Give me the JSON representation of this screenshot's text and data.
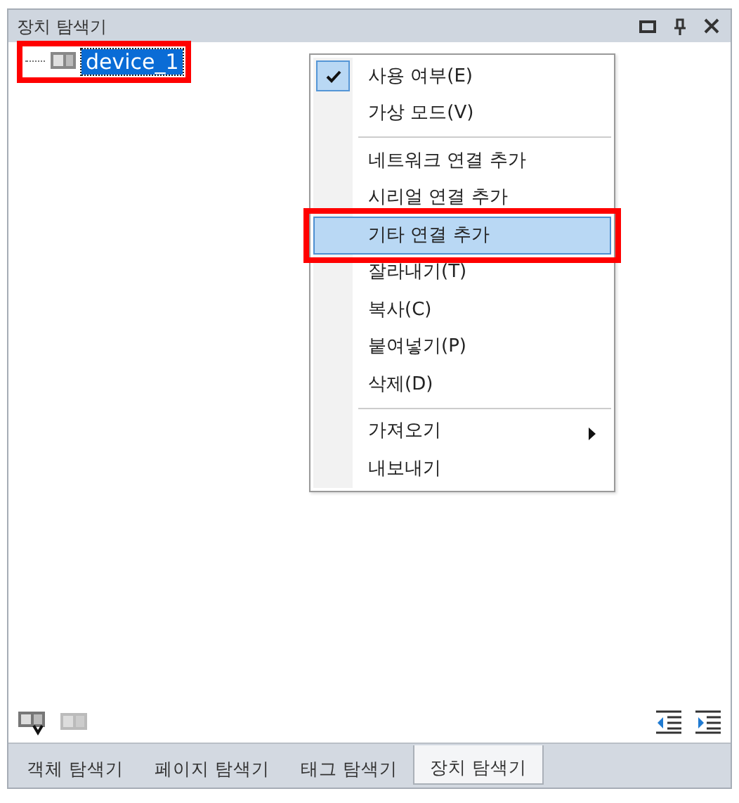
{
  "panel": {
    "title": "장치 탐색기"
  },
  "tree": [
    {
      "label": "device_1",
      "selected": true,
      "highlighted": true
    }
  ],
  "context_menu": [
    {
      "kind": "item",
      "label": "사용 여부(E)",
      "checked": true,
      "selected": false,
      "highlighted": false,
      "submenu": false
    },
    {
      "kind": "item",
      "label": "가상 모드(V)",
      "checked": false,
      "selected": false,
      "highlighted": false,
      "submenu": false
    },
    {
      "kind": "separator"
    },
    {
      "kind": "item",
      "label": "네트워크 연결 추가",
      "checked": false,
      "selected": false,
      "highlighted": false,
      "submenu": false
    },
    {
      "kind": "item",
      "label": "시리얼 연결 추가",
      "checked": false,
      "selected": false,
      "highlighted": false,
      "submenu": false
    },
    {
      "kind": "item",
      "label": "기타 연결 추가",
      "checked": false,
      "selected": true,
      "highlighted": true,
      "submenu": false
    },
    {
      "kind": "item",
      "label": "잘라내기(T)",
      "checked": false,
      "selected": false,
      "highlighted": false,
      "submenu": false
    },
    {
      "kind": "item",
      "label": "복사(C)",
      "checked": false,
      "selected": false,
      "highlighted": false,
      "submenu": false
    },
    {
      "kind": "item",
      "label": "붙여넣기(P)",
      "checked": false,
      "selected": false,
      "highlighted": false,
      "submenu": false
    },
    {
      "kind": "item",
      "label": "삭제(D)",
      "checked": false,
      "selected": false,
      "highlighted": false,
      "submenu": false
    },
    {
      "kind": "separator"
    },
    {
      "kind": "item",
      "label": "가져오기",
      "checked": false,
      "selected": false,
      "highlighted": false,
      "submenu": true
    },
    {
      "kind": "item",
      "label": "내보내기",
      "checked": false,
      "selected": false,
      "highlighted": false,
      "submenu": false
    }
  ],
  "tabs": [
    {
      "label": "객체 탐색기",
      "selected": false
    },
    {
      "label": "페이지 탐색기",
      "selected": false
    },
    {
      "label": "태그 탐색기",
      "selected": false
    },
    {
      "label": "장치 탐색기",
      "selected": true
    }
  ]
}
